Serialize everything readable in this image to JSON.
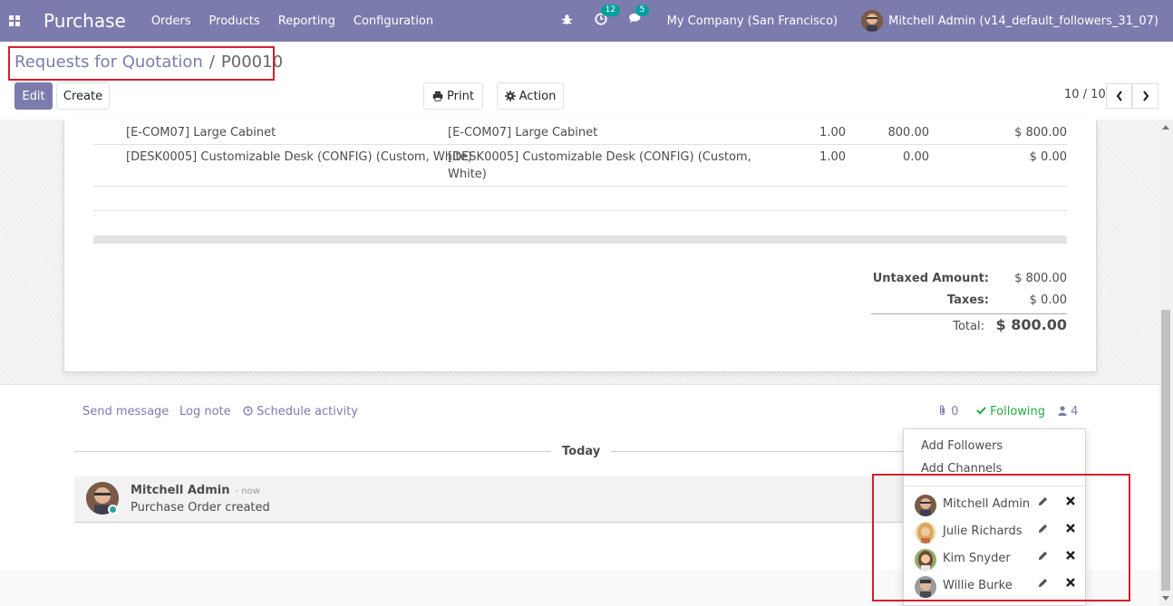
{
  "navbar": {
    "app_name": "Purchase",
    "menus": [
      "Orders",
      "Products",
      "Reporting",
      "Configuration"
    ],
    "activity_count": "12",
    "message_count": "5",
    "company": "My Company (San Francisco)",
    "user": "Mitchell Admin (v14_default_followers_31_07)"
  },
  "breadcrumb": {
    "parent": "Requests for Quotation",
    "separator": "/",
    "current": "P00010"
  },
  "buttons": {
    "edit": "Edit",
    "create": "Create",
    "print": "Print",
    "action": "Action"
  },
  "pager": {
    "value": "10 / 10"
  },
  "order_lines": [
    {
      "product": "[E-COM07] Large Cabinet",
      "description": "[E-COM07] Large Cabinet",
      "description_cont": "",
      "qty": "1.00",
      "unit_price": "800.00",
      "subtotal": "$ 800.00"
    },
    {
      "product": "[DESK0005] Customizable Desk (CONFIG) (Custom, White)",
      "description": "[DESK0005] Customizable Desk (CONFIG) (Custom,",
      "description_cont": "White)",
      "qty": "1.00",
      "unit_price": "0.00",
      "subtotal": "$ 0.00"
    }
  ],
  "totals": {
    "untaxed_label": "Untaxed Amount:",
    "untaxed_value": "$ 800.00",
    "taxes_label": "Taxes:",
    "taxes_value": "$ 0.00",
    "total_label": "Total:",
    "total_value": "$ 800.00"
  },
  "chatter": {
    "send_message": "Send message",
    "log_note": "Log note",
    "schedule_activity": "Schedule activity",
    "attachments_count": "0",
    "following": "Following",
    "followers_count": "4",
    "date_separator": "Today",
    "message": {
      "author": "Mitchell Admin",
      "time": "- now",
      "body": "Purchase Order created"
    }
  },
  "followers_dropdown": {
    "add_followers": "Add Followers",
    "add_channels": "Add Channels",
    "followers": [
      "Mitchell Admin",
      "Julie Richards",
      "Kim Snyder",
      "Willie Burke"
    ]
  },
  "colors": {
    "brand": "#7c7bad",
    "highlight": "#d3202c",
    "following": "#28a745"
  }
}
